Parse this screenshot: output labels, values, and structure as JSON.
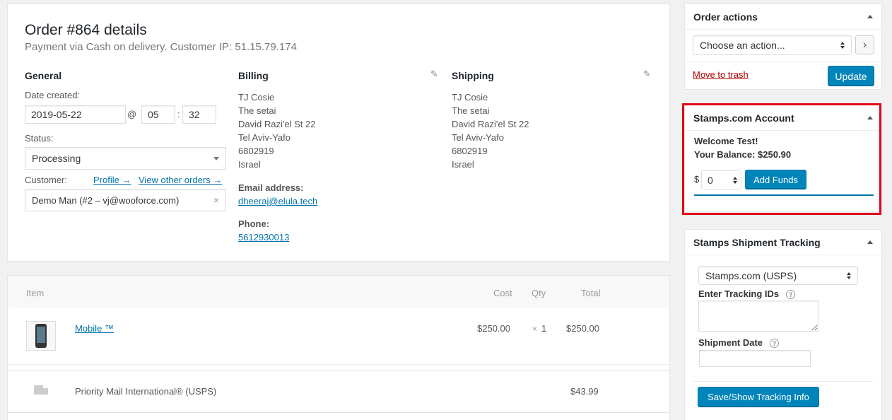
{
  "order": {
    "title": "Order #864 details",
    "subtitle": "Payment via Cash on delivery. Customer IP: 51.15.79.174",
    "general": {
      "heading": "General",
      "date_label": "Date created:",
      "date": "2019-05-22",
      "at": "@",
      "hour": "05",
      "colon": ":",
      "minute": "32",
      "status_label": "Status:",
      "status": "Processing",
      "customer_label": "Customer:",
      "profile_link": "Profile →",
      "other_orders_link": "View other orders →",
      "customer": "Demo Man (#2 – vj@wooforce.com)",
      "clear": "×"
    },
    "billing": {
      "heading": "Billing",
      "lines": [
        "TJ Cosie",
        "The setai",
        "David Razi'el St 22",
        "Tel Aviv-Yafo",
        "6802919",
        "Israel"
      ],
      "email_label": "Email address:",
      "email": "dheeraj@elula.tech",
      "phone_label": "Phone:",
      "phone": "5612930013"
    },
    "shipping": {
      "heading": "Shipping",
      "lines": [
        "TJ Cosie",
        "The setai",
        "David Razi'el St 22",
        "Tel Aviv-Yafo",
        "6802919",
        "Israel"
      ]
    }
  },
  "items": {
    "headers": {
      "item": "Item",
      "cost": "Cost",
      "qty": "Qty",
      "total": "Total"
    },
    "product": {
      "name": "Mobile ™",
      "cost": "$250.00",
      "qty_x": "×",
      "qty": "1",
      "total": "$250.00"
    },
    "shipping_line": {
      "name": "Priority Mail International® (USPS)",
      "total": "$43.99"
    }
  },
  "order_actions": {
    "title": "Order actions",
    "select": "Choose an action...",
    "go": "›",
    "trash": "Move to trash",
    "update": "Update"
  },
  "stamps_account": {
    "title": "Stamps.com Account",
    "welcome": "Welcome Test!",
    "balance": "Your Balance: $250.90",
    "currency": "$",
    "amount": "0",
    "add_funds": "Add Funds",
    "highlight_color": "#e0001b"
  },
  "tracking": {
    "title": "Stamps Shipment Tracking",
    "provider": "Stamps.com (USPS)",
    "tracking_label": "Enter Tracking IDs",
    "help": "?",
    "date_label": "Shipment Date",
    "button": "Save/Show Tracking Info"
  }
}
